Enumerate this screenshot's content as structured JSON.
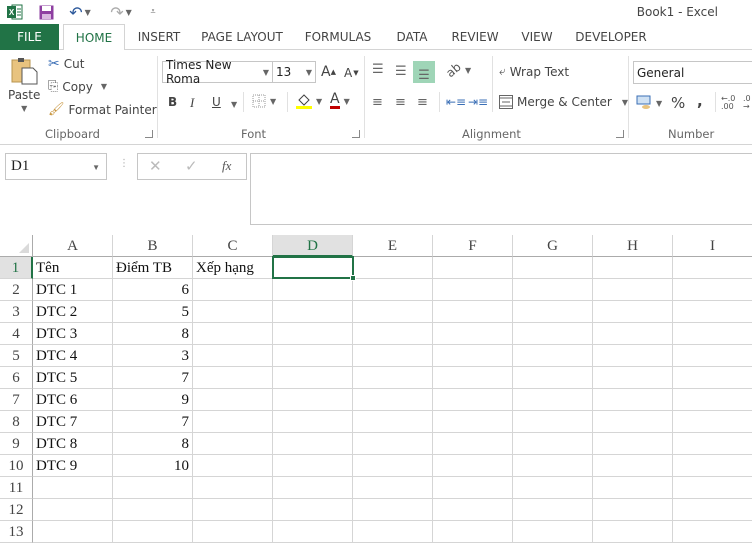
{
  "app": {
    "title": "Book1 - Excel",
    "accent_color": "#217346"
  },
  "quick_access": {
    "icons": [
      "excel-logo-icon",
      "save-icon",
      "undo-icon",
      "redo-icon",
      "customize-qat-icon"
    ]
  },
  "tabs": [
    {
      "label": "FILE"
    },
    {
      "label": "HOME",
      "active": true
    },
    {
      "label": "INSERT"
    },
    {
      "label": "PAGE LAYOUT"
    },
    {
      "label": "FORMULAS"
    },
    {
      "label": "DATA"
    },
    {
      "label": "REVIEW"
    },
    {
      "label": "VIEW"
    },
    {
      "label": "DEVELOPER"
    }
  ],
  "ribbon": {
    "clipboard": {
      "label": "Clipboard",
      "paste": "Paste",
      "cut": "Cut",
      "copy": "Copy",
      "format_painter": "Format Painter"
    },
    "font": {
      "label": "Font",
      "font_name": "Times New Roma",
      "font_size": "13",
      "bold": "B",
      "italic": "I",
      "underline": "U",
      "grow": "A",
      "shrink": "A",
      "highlight_color": "#ffff00",
      "font_color": "#c00000"
    },
    "alignment": {
      "label": "Alignment",
      "wrap_text": "Wrap Text",
      "merge_center": "Merge & Center"
    },
    "number": {
      "label": "Number",
      "format": "General",
      "percent": "%",
      "comma": ","
    }
  },
  "formula_bar": {
    "name_box": "D1",
    "fx_label": "fx",
    "formula": ""
  },
  "sheet": {
    "selected_cell": "D1",
    "columns": [
      "A",
      "B",
      "C",
      "D",
      "E",
      "F",
      "G",
      "H",
      "I"
    ],
    "rows": [
      "1",
      "2",
      "3",
      "4",
      "5",
      "6",
      "7",
      "8",
      "9",
      "10",
      "11",
      "12",
      "13"
    ],
    "cells": {
      "A1": "Tên",
      "B1": "Điểm TB",
      "C1": "Xếp hạng",
      "A2": "DTC 1",
      "B2": "6",
      "A3": "DTC 2",
      "B3": "5",
      "A4": "DTC 3",
      "B4": "8",
      "A5": "DTC 4",
      "B5": "3",
      "A6": "DTC 5",
      "B6": "7",
      "A7": "DTC 6",
      "B7": "9",
      "A8": "DTC 7",
      "B8": "7",
      "A9": "DTC 8",
      "B9": "8",
      "A10": "DTC 9",
      "B10": "10"
    }
  }
}
